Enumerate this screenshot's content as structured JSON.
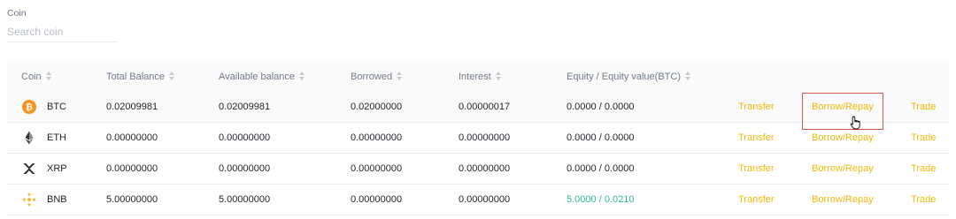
{
  "filter": {
    "label": "Coin",
    "placeholder": "Search coin",
    "value": ""
  },
  "table": {
    "headers": {
      "coin": "Coin",
      "total_balance": "Total Balance",
      "available_balance": "Available balance",
      "borrowed": "Borrowed",
      "interest": "Interest",
      "equity": "Equity / Equity value(BTC)"
    },
    "rows": [
      {
        "icon": "btc-icon",
        "coin": "BTC",
        "total": "0.02009981",
        "available": "0.02009981",
        "borrowed": "0.02000000",
        "interest": "0.00000017",
        "equity": "0.0000 / 0.0000",
        "transfer": "Transfer",
        "borrow": "Borrow/Repay",
        "trade": "Trade"
      },
      {
        "icon": "eth-icon",
        "coin": "ETH",
        "total": "0.00000000",
        "available": "0.00000000",
        "borrowed": "0.00000000",
        "interest": "0.00000000",
        "equity": "0.0000 / 0.0000",
        "transfer": "Transfer",
        "borrow": "Borrow/Repay",
        "trade": "Trade"
      },
      {
        "icon": "xrp-icon",
        "coin": "XRP",
        "total": "0.00000000",
        "available": "0.00000000",
        "borrowed": "0.00000000",
        "interest": "0.00000000",
        "equity": "0.0000 / 0.0000",
        "transfer": "Transfer",
        "borrow": "Borrow/Repay",
        "trade": "Trade"
      },
      {
        "icon": "bnb-icon",
        "coin": "BNB",
        "total": "5.00000000",
        "available": "5.00000000",
        "borrowed": "0.00000000",
        "interest": "0.00000000",
        "equity": "5.0000 / 0.0210",
        "transfer": "Transfer",
        "borrow": "Borrow/Repay",
        "trade": "Trade"
      }
    ]
  },
  "colors": {
    "accent": "#f0b90b",
    "positive": "#2ebd85",
    "highlight": "#d9534f",
    "btc": "#f7931a",
    "bnb": "#f3ba2f"
  }
}
